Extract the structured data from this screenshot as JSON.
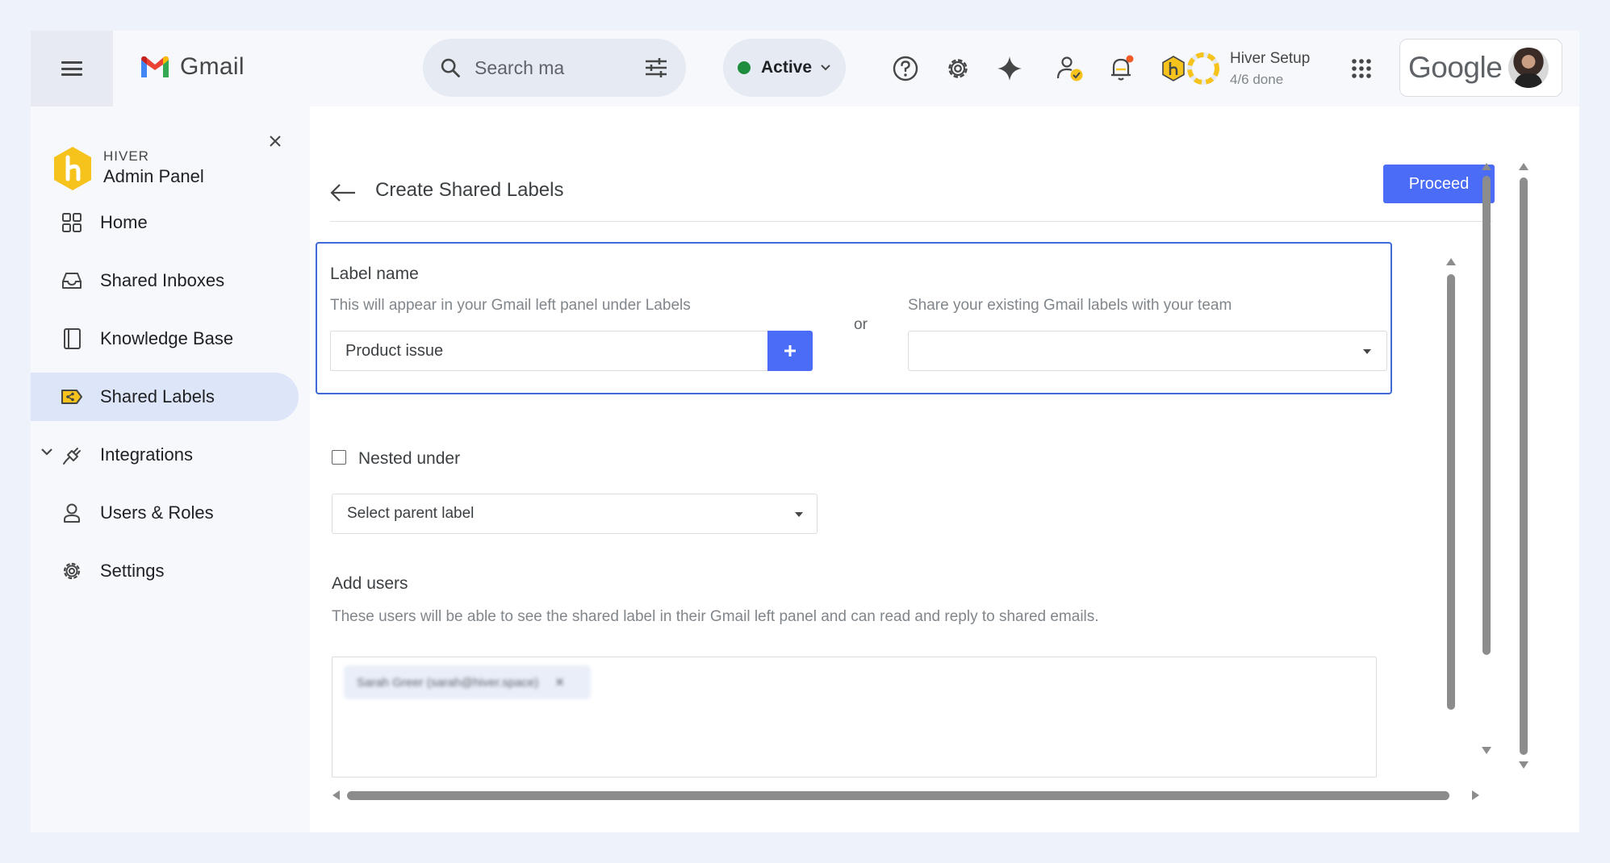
{
  "topbar": {
    "app_name": "Gmail",
    "search_placeholder": "Search ma",
    "status": "Active",
    "setup": {
      "title": "Hiver Setup",
      "progress": "4/6 done",
      "done": 4,
      "total": 6
    },
    "account_brand": "Google",
    "icons": [
      "menu-icon",
      "search-icon",
      "filter-sliders-icon",
      "chevron-down-icon",
      "help-icon",
      "gear-icon",
      "sparkle-icon",
      "user-check-icon",
      "bell-icon",
      "hiver-icon",
      "apps-grid-icon"
    ]
  },
  "sidebar": {
    "brand_small": "HIVER",
    "brand_title": "Admin Panel",
    "items": [
      {
        "label": "Home",
        "icon": "grid-icon",
        "active": false
      },
      {
        "label": "Shared Inboxes",
        "icon": "inbox-icon",
        "active": false
      },
      {
        "label": "Knowledge Base",
        "icon": "book-icon",
        "active": false
      },
      {
        "label": "Shared Labels",
        "icon": "shared-label-icon",
        "active": true
      },
      {
        "label": "Integrations",
        "icon": "plug-icon",
        "active": false,
        "expandable": true
      },
      {
        "label": "Users & Roles",
        "icon": "user-icon",
        "active": false
      },
      {
        "label": "Settings",
        "icon": "gear-icon",
        "active": false
      }
    ]
  },
  "main": {
    "title": "Create Shared Labels",
    "proceed_label": "Proceed",
    "label_name": {
      "title": "Label name",
      "hint": "This will appear in your Gmail left panel under Labels",
      "value": "Product issue"
    },
    "or_text": "or",
    "share_existing": {
      "hint": "Share your existing Gmail labels with your team",
      "value": ""
    },
    "nested": {
      "label": "Nested under",
      "checked": false,
      "select_placeholder": "Select parent label"
    },
    "add_users": {
      "title": "Add users",
      "hint": "These users will be able to see the shared label in their Gmail left panel and can read and reply to shared emails.",
      "chips": [
        "Sarah Greer (sarah@hiver.space)"
      ]
    }
  },
  "colors": {
    "accent": "#4a6cf7",
    "active_status": "#1e8e3e",
    "active_nav": "#dde6f8",
    "card_border": "#3f6ad8",
    "hiver_yellow": "#f6c21c"
  }
}
